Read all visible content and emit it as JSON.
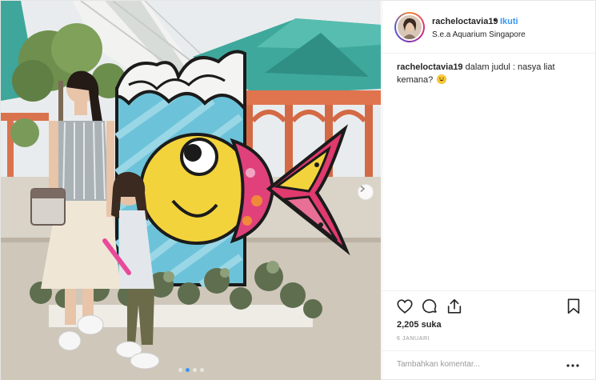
{
  "post": {
    "username": "racheloctavia19",
    "separator": "•",
    "follow_label": "Ikuti",
    "location": "S.e.a Aquarium Singapore",
    "caption": {
      "username": "racheloctavia19",
      "text": " dalam judul : nasya liat kemana?"
    },
    "likes": "2,205 suka",
    "date": "6 JANUARI",
    "comment_placeholder": "Tambahkan komentar...",
    "carousel_dots": 4,
    "active_dot": 1
  },
  "icons": {
    "like": "heart-icon",
    "comment": "comment-icon",
    "share": "share-icon",
    "save": "bookmark-icon",
    "more": "more-options-icon",
    "next": "chevron-right-icon",
    "emoji": "grinning-face-emoji"
  },
  "colors": {
    "link_blue": "#3897f0",
    "text": "#262626",
    "muted": "#999999",
    "border": "#efefef"
  }
}
